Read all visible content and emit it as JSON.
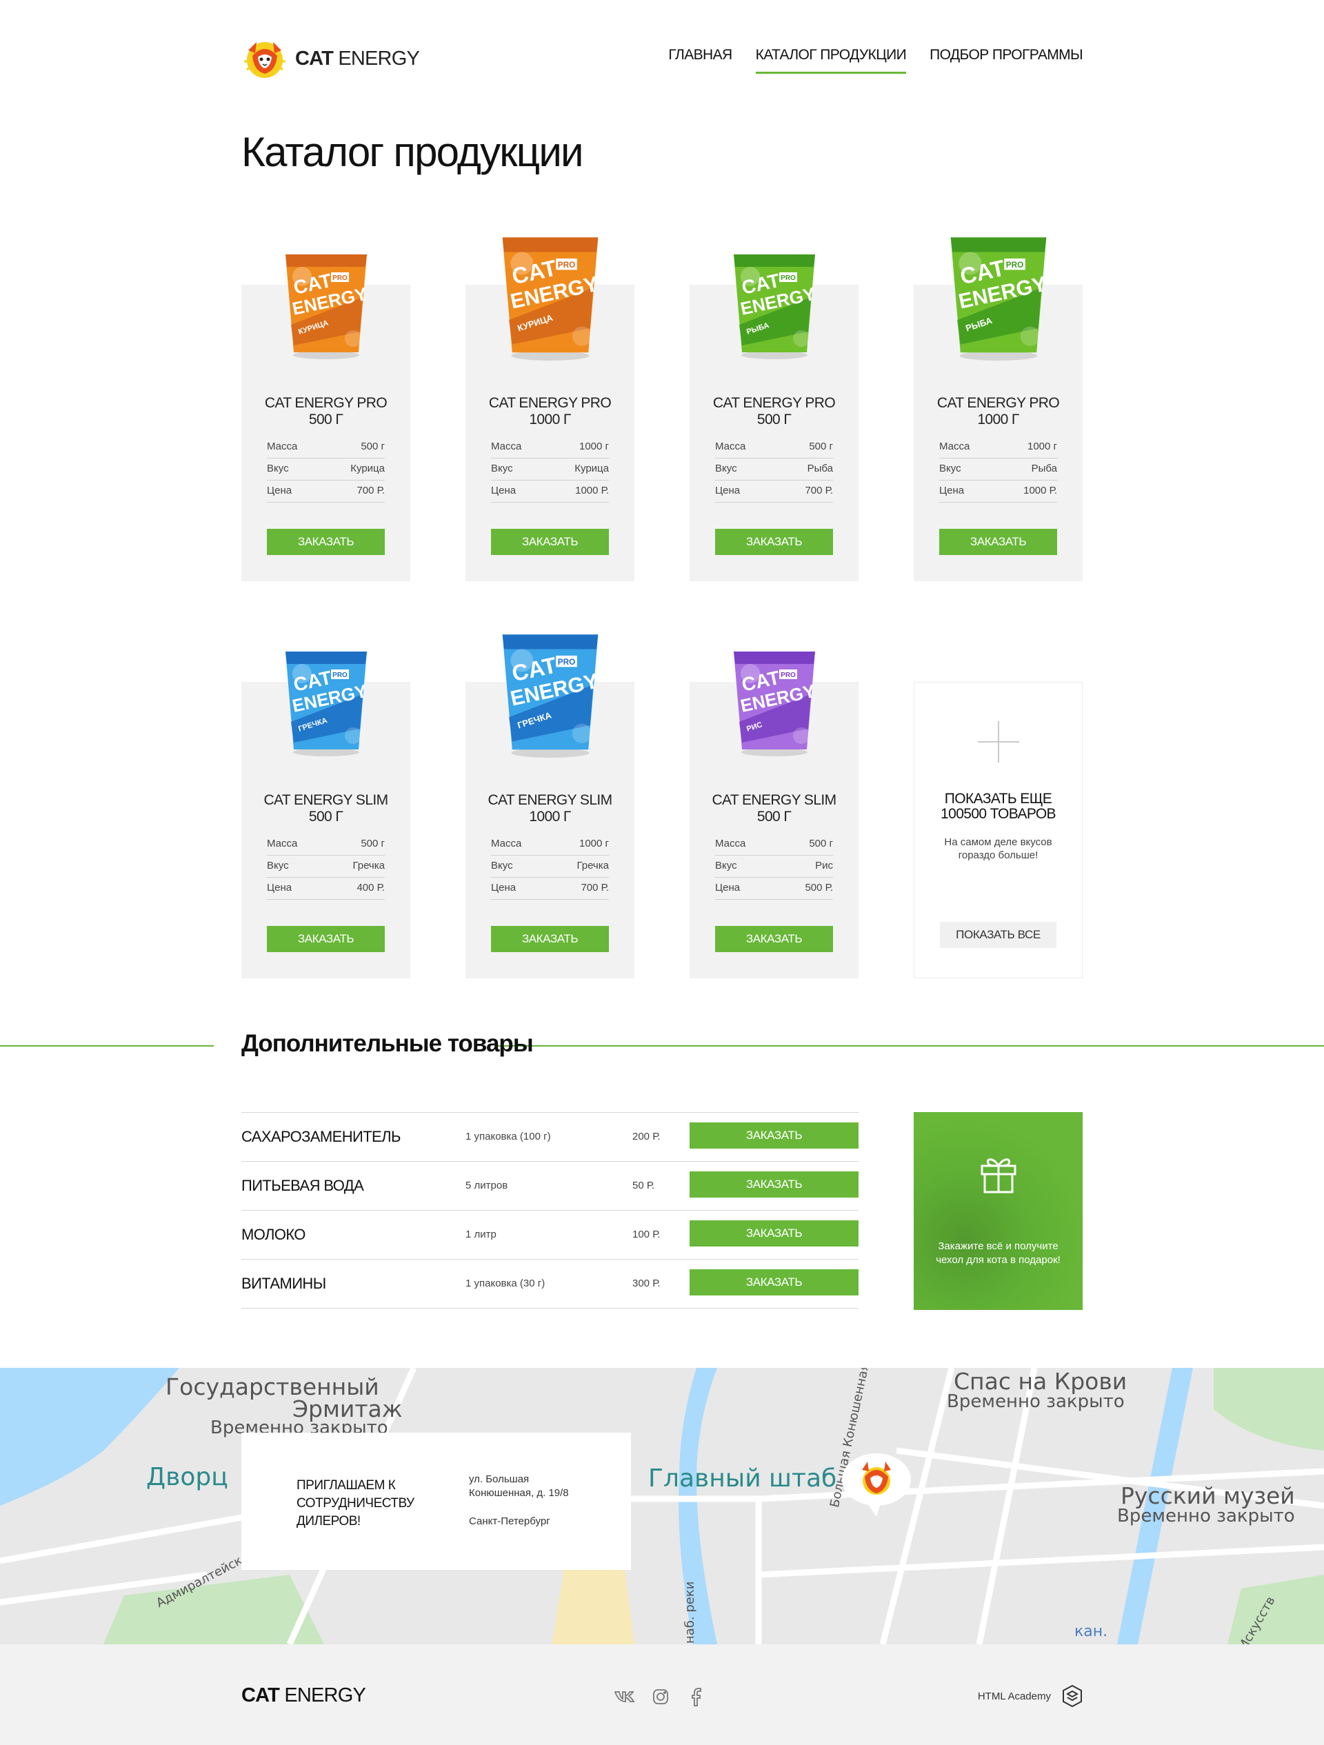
{
  "header": {
    "logo": {
      "bold": "CAT",
      "light": "ENERGY"
    },
    "nav": [
      {
        "label": "ГЛАВНАЯ",
        "active": false
      },
      {
        "label": "КАТАЛОГ ПРОДУКЦИИ",
        "active": true
      },
      {
        "label": "ПОДБОР ПРОГРАММЫ",
        "active": false
      }
    ]
  },
  "page_title": "Каталог продукции",
  "products": [
    {
      "name1": "CAT ENERGY PRO",
      "name2": "500 Г",
      "mass_label": "Масса",
      "mass": "500 г",
      "taste_label": "Вкус",
      "taste": "Курица",
      "price_label": "Цена",
      "price": "700 Р.",
      "button": "ЗАКАЗАТЬ",
      "pack_label": "КУРИЦА",
      "color": "#f08a1c",
      "dark": "#d5661a"
    },
    {
      "name1": "CAT ENERGY PRO",
      "name2": "1000 Г",
      "mass_label": "Масса",
      "mass": "1000 г",
      "taste_label": "Вкус",
      "taste": "Курица",
      "price_label": "Цена",
      "price": "1000 Р.",
      "button": "ЗАКАЗАТЬ",
      "pack_label": "КУРИЦА",
      "color": "#f08a1c",
      "dark": "#d5661a"
    },
    {
      "name1": "CAT ENERGY PRO",
      "name2": "500 Г",
      "mass_label": "Масса",
      "mass": "500 г",
      "taste_label": "Вкус",
      "taste": "Рыба",
      "price_label": "Цена",
      "price": "700 Р.",
      "button": "ЗАКАЗАТЬ",
      "pack_label": "РЫБА",
      "color": "#6fbf2a",
      "dark": "#3f9a1f"
    },
    {
      "name1": "CAT ENERGY PRO",
      "name2": "1000 Г",
      "mass_label": "Масса",
      "mass": "1000 г",
      "taste_label": "Вкус",
      "taste": "Рыба",
      "price_label": "Цена",
      "price": "1000 Р.",
      "button": "ЗАКАЗАТЬ",
      "pack_label": "РЫБА",
      "color": "#6fbf2a",
      "dark": "#3f9a1f"
    },
    {
      "name1": "CAT ENERGY SLIM",
      "name2": "500 Г",
      "mass_label": "Масса",
      "mass": "500 г",
      "taste_label": "Вкус",
      "taste": "Гречка",
      "price_label": "Цена",
      "price": "400 Р.",
      "button": "ЗАКАЗАТЬ",
      "pack_label": "ГРЕЧКА",
      "color": "#3aa5e8",
      "dark": "#1d6fc4"
    },
    {
      "name1": "CAT ENERGY SLIM",
      "name2": "1000 Г",
      "mass_label": "Масса",
      "mass": "1000 г",
      "taste_label": "Вкус",
      "taste": "Гречка",
      "price_label": "Цена",
      "price": "700 Р.",
      "button": "ЗАКАЗАТЬ",
      "pack_label": "ГРЕЧКА",
      "color": "#3aa5e8",
      "dark": "#1d6fc4"
    },
    {
      "name1": "CAT ENERGY SLIM",
      "name2": "500 Г",
      "mass_label": "Масса",
      "mass": "500 г",
      "taste_label": "Вкус",
      "taste": "Рис",
      "price_label": "Цена",
      "price": "500 Р.",
      "button": "ЗАКАЗАТЬ",
      "pack_label": "РИС",
      "color": "#a86de0",
      "dark": "#7b3fc4"
    }
  ],
  "pack_text": {
    "top": "CAT",
    "bottom": "ENERGY",
    "badge": "PRO"
  },
  "more": {
    "title_line1": "ПОКАЗАТЬ ЕЩЕ",
    "title_line2": "100500 ТОВАРОВ",
    "text": "На самом деле вкусов гораздо больше!",
    "button": "ПОКАЗАТЬ ВСЕ"
  },
  "additional": {
    "title": "Дополнительные товары",
    "rows": [
      {
        "name": "САХАРОЗАМЕНИТЕЛЬ",
        "qty": "1 упаковка (100 г)",
        "price": "200 Р.",
        "button": "ЗАКАЗАТЬ"
      },
      {
        "name": "ПИТЬЕВАЯ ВОДА",
        "qty": "5 литров",
        "price": "50 Р.",
        "button": "ЗАКАЗАТЬ"
      },
      {
        "name": "МОЛОКО",
        "qty": "1 литр",
        "price": "100 Р.",
        "button": "ЗАКАЗАТЬ"
      },
      {
        "name": "ВИТАМИНЫ",
        "qty": "1 упаковка (30 г)",
        "price": "300 Р.",
        "button": "ЗАКАЗАТЬ"
      }
    ],
    "gift_text": "Закажите всё и получите чехол для кота в подарок!"
  },
  "map": {
    "labels": {
      "hermitage1": "Государственный",
      "hermitage2": "Эрмитаж",
      "hermitage3": "Временно закрыто",
      "palace": "Дворц",
      "admiralty": "Адмиралтейск",
      "staff": "Главный штаб",
      "church1": "Спас на Крови",
      "church2": "Временно закрыто",
      "museum1": "Русский музей",
      "museum2": "Временно закрыто",
      "street1": "Большая Конюшенная ул.",
      "street2": "наб. реки",
      "street3": "Искусств",
      "street4": "кан."
    },
    "card_title": "ПРИГЛАШАЕМ К СОТРУДНИЧЕСТВУ ДИЛЕРОВ!",
    "address_line1": "ул. Большая",
    "address_line2": "Конюшенная, д. 19/8",
    "city": "Санкт-Петербург"
  },
  "footer": {
    "logo": {
      "bold": "CAT",
      "light": "ENERGY"
    },
    "socials": [
      "vk-icon",
      "instagram-icon",
      "facebook-icon"
    ],
    "academy": "HTML Academy"
  }
}
